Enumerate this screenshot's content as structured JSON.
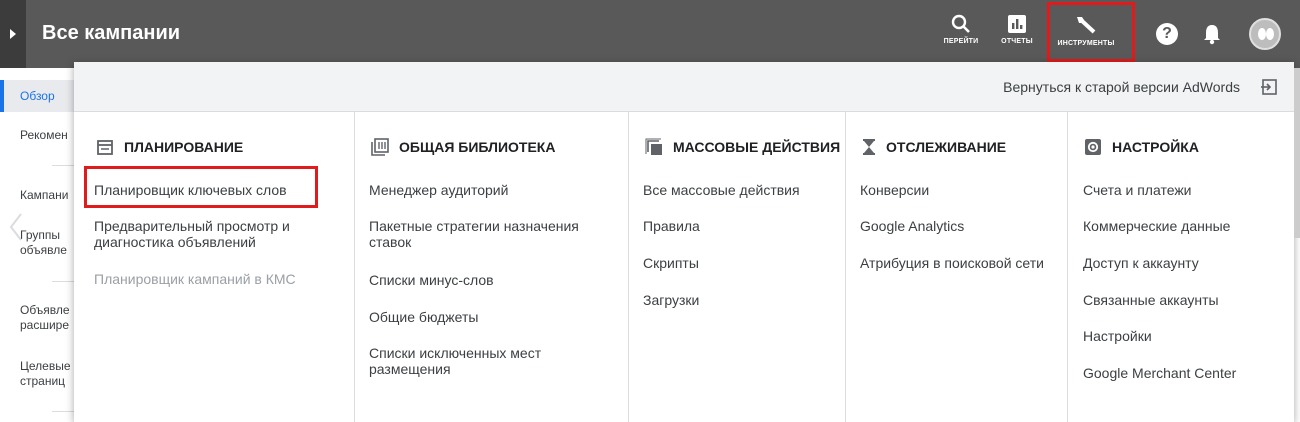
{
  "header": {
    "title": "Все кампании",
    "buttons": [
      {
        "label": "ПЕРЕЙТИ",
        "icon": "search-icon"
      },
      {
        "label": "ОТЧЕТЫ",
        "icon": "reports-icon"
      },
      {
        "label": "ИНСТРУМЕНТЫ",
        "icon": "wrench-icon"
      }
    ],
    "icons": [
      "help-icon",
      "bell-icon",
      "avatar"
    ]
  },
  "sidebar": {
    "items": [
      {
        "label": "Обзор",
        "active": true
      },
      {
        "label": "Рекомен"
      },
      {
        "label": "Кампани"
      },
      {
        "label": "Группы"
      },
      {
        "label": "объявле"
      },
      {
        "label": "Объявле"
      },
      {
        "label": "расшире"
      },
      {
        "label": "Целевые"
      },
      {
        "label": "страниц"
      }
    ]
  },
  "menu": {
    "back_link": "Вернуться к старой версии AdWords",
    "columns": [
      {
        "title": "ПЛАНИРОВАНИЕ",
        "icon": "calendar-icon",
        "items": [
          "Планировщик ключевых слов",
          "Предварительный просмотр и диагностика объявлений",
          "Планировщик кампаний в КМС"
        ]
      },
      {
        "title": "ОБЩАЯ БИБЛИОТЕКА",
        "icon": "library-icon",
        "items": [
          "Менеджер аудиторий",
          "Пакетные стратегии назначения ставок",
          "Списки минус-слов",
          "Общие бюджеты",
          "Списки исключенных мест размещения"
        ]
      },
      {
        "title": "МАССОВЫЕ ДЕЙСТВИЯ",
        "icon": "copy-icon",
        "items": [
          "Все массовые действия",
          "Правила",
          "Скрипты",
          "Загрузки"
        ]
      },
      {
        "title": "ОТСЛЕЖИВАНИЕ",
        "icon": "hourglass-icon",
        "items": [
          "Конверсии",
          "Google Analytics",
          "Атрибуция в поисковой сети"
        ]
      },
      {
        "title": "НАСТРОЙКА",
        "icon": "gear-icon",
        "items": [
          "Счета и платежи",
          "Коммерческие данные",
          "Доступ к аккаунту",
          "Связанные аккаунты",
          "Настройки",
          "Google Merchant Center"
        ]
      }
    ]
  },
  "colors": {
    "topbar": "#595959",
    "highlight": "#e01b1b",
    "accent": "#1a73e8"
  }
}
